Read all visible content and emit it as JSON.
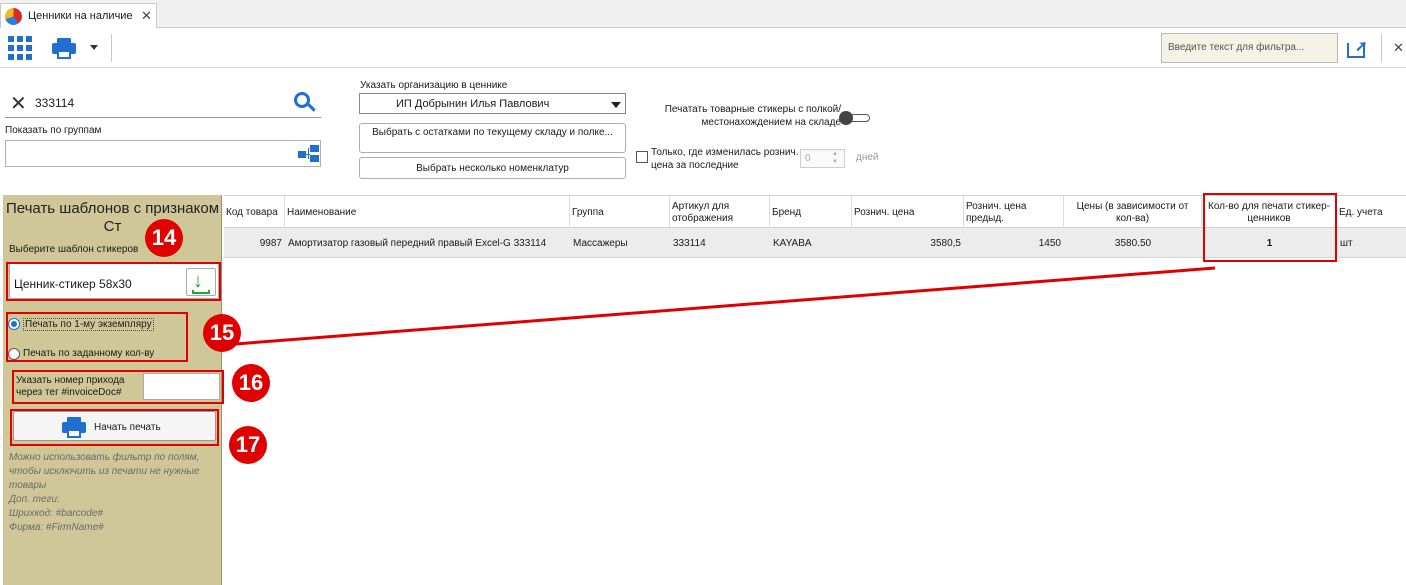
{
  "tab": {
    "title": "Ценники на наличие",
    "close": "✕"
  },
  "toolbar": {
    "filter_placeholder": "Введите текст для фильтра...",
    "close": "✕"
  },
  "filters": {
    "search_value": "333114",
    "groups_label": "Показать по группам",
    "org_label": "Указать организацию в ценнике",
    "org_value": "ИП Добрынин Илья Павлович",
    "btn_stock": "Выбрать с остатками по текущему складу и полке...",
    "btn_nomen": "Выбрать несколько номенклатур",
    "stickers_toggle_label": "Печатать товарные стикеры с полкой/местонахождением на складе",
    "stickers_toggle_on": false,
    "changed_checkbox_label": "Только, где изменилась рознич. цена за последние",
    "changed_checked": false,
    "days_value": "0",
    "days_label": "дней"
  },
  "left_panel": {
    "title": "Печать шаблонов с признаком Ст",
    "template_label": "Выберите шаблон стикеров",
    "template_value": "Ценник-стикер 58х30",
    "radio_one": "Печать по 1-му экземпляру",
    "radio_qty": "Печать по заданному кол-ву",
    "radio_selected": "one",
    "invoice_label": "Указать номер прихода через тег  #invoiceDoc#",
    "invoice_value": "",
    "print_button": "Начать печать",
    "hint_lines": [
      "Можно использовать фильтр по полям, чтобы исключить из печати не нужные товары",
      "Доп. теги:",
      "Шрихкод: #barcode#",
      "Фирма: #FirmName#"
    ]
  },
  "table": {
    "columns": [
      "Код товара",
      "Наименование",
      "Группа",
      "Артикул для отображения",
      "Бренд",
      "Рознич. цена",
      "Рознич. цена предыд.",
      "Цены (в зависимости от кол-ва)",
      "Кол-во для печати стикер-ценников",
      "Ед. учета"
    ],
    "rows": [
      [
        "9987",
        "Амортизатор газовый передний правый Excel-G 333114",
        "Массажеры",
        "333114",
        "KAYABA",
        "3580,5",
        "1450",
        "3580.50",
        "1",
        "шт"
      ]
    ]
  },
  "annotations": {
    "n14": "14",
    "n15": "15",
    "n16": "16",
    "n17": "17"
  },
  "colors": {
    "accent": "#1f6fd1",
    "panel": "#cfc798",
    "annotation": "#e00000",
    "download": "#27a33a"
  }
}
